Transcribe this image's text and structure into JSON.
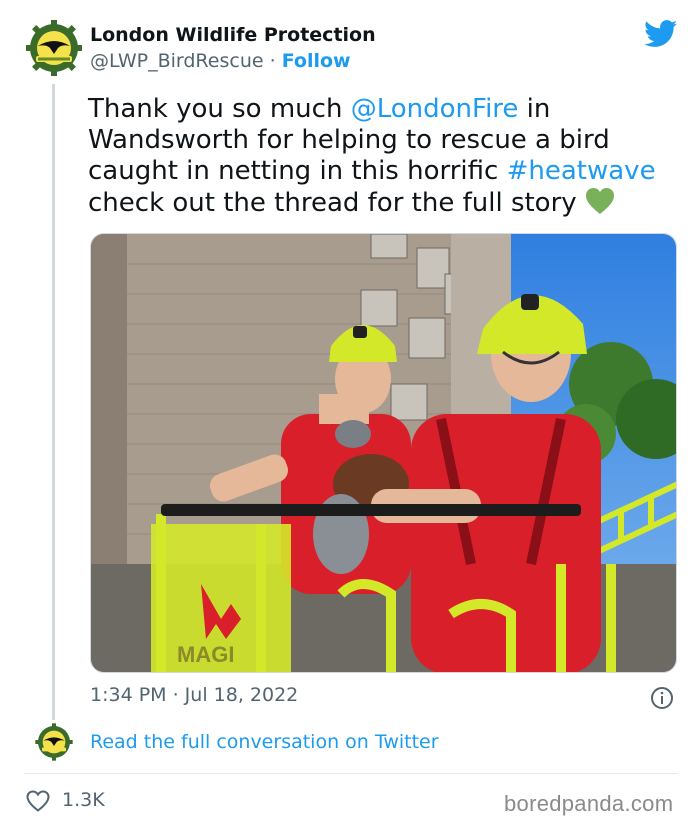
{
  "author": {
    "name": "London Wildlife Protection",
    "handle": "@LWP_BirdRescue",
    "separator": " · ",
    "follow_label": "Follow",
    "avatar_icon": "wildlife-crest-icon"
  },
  "tweet": {
    "line1_pre": "Thank you so much ",
    "line1_mention": "@LondonFire",
    "line1_post": " in",
    "line2": "Wandsworth for helping to rescue a bird",
    "line3_pre": "caught in netting in this horrific ",
    "line3_hashtag": "#heatwave",
    "line4": " check out the thread for the full story ",
    "emoji_icon": "green-heart-icon"
  },
  "photo": {
    "icon": "firefighters-holding-pigeon-photo",
    "vehicle_text": "MAGI"
  },
  "meta": {
    "timestamp": "1:34 PM · Jul 18, 2022",
    "info_icon": "info-icon"
  },
  "thread": {
    "read_link": "Read the full conversation on Twitter"
  },
  "engagement": {
    "likes": "1.3K",
    "like_icon": "heart-outline-icon"
  },
  "watermark": "boredpanda.com",
  "colors": {
    "link": "#1d9bf0",
    "text": "#0f1419",
    "muted": "#536471",
    "heart_emoji": "#78b159",
    "helmet": "#d4e82a",
    "shirt": "#d81f2a"
  }
}
